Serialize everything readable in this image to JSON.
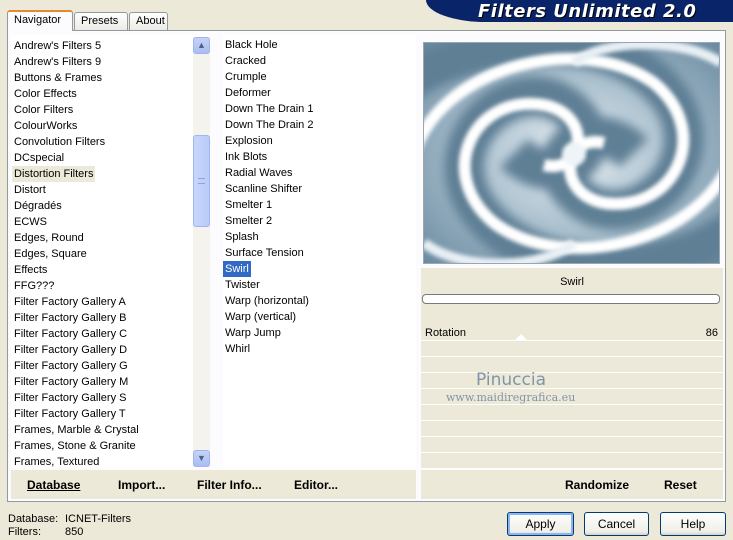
{
  "tabs": [
    {
      "label": "Navigator",
      "active": true
    },
    {
      "label": "Presets",
      "active": false
    },
    {
      "label": "About",
      "active": false
    }
  ],
  "title": "Filters Unlimited 2.0",
  "categories": {
    "items": [
      "Andrew's Filters 5",
      "Andrew's Filters 9",
      "Buttons & Frames",
      "Color Effects",
      "Color Filters",
      "ColourWorks",
      "Convolution Filters",
      "DCspecial",
      "Distortion Filters",
      "Distort",
      "Dégradés",
      "ECWS",
      "Edges, Round",
      "Edges, Square",
      "Effects",
      "FFG???",
      "Filter Factory Gallery A",
      "Filter Factory Gallery B",
      "Filter Factory Gallery C",
      "Filter Factory Gallery D",
      "Filter Factory Gallery G",
      "Filter Factory Gallery M",
      "Filter Factory Gallery S",
      "Filter Factory Gallery T",
      "Frames, Marble & Crystal",
      "Frames, Stone & Granite",
      "Frames, Textured"
    ],
    "selected": "Distortion Filters"
  },
  "filters": {
    "items": [
      "Black Hole",
      "Cracked",
      "Crumple",
      "Deformer",
      "Down The Drain 1",
      "Down The Drain 2",
      "Explosion",
      "Ink Blots",
      "Radial Waves",
      "Scanline Shifter",
      "Smelter 1",
      "Smelter 2",
      "Splash",
      "Surface Tension",
      "Swirl",
      "Twister",
      "Warp (horizontal)",
      "Warp (vertical)",
      "Warp Jump",
      "Whirl"
    ],
    "selected": "Swirl"
  },
  "params": {
    "filter_name": "Swirl",
    "rotation_label": "Rotation",
    "rotation_value": "86"
  },
  "watermark": {
    "name": "Pinuccia",
    "url": "www.maidiregrafica.eu"
  },
  "bottom_links": {
    "database": "Database",
    "import": "Import...",
    "filter_info": "Filter Info...",
    "editor": "Editor...",
    "randomize": "Randomize",
    "reset": "Reset"
  },
  "status": {
    "database_label": "Database:",
    "database_value": "ICNET-Filters",
    "filters_label": "Filters:",
    "filters_value": "850"
  },
  "buttons": {
    "apply": "Apply",
    "cancel": "Cancel",
    "help": "Help"
  },
  "colors": {
    "title_bar": "#0a246a",
    "selection_blue": "#316ac5",
    "selection_grey": "#ece9d8"
  },
  "icons": {
    "scroll_up": "chevron-up-icon",
    "scroll_down": "chevron-down-icon"
  }
}
